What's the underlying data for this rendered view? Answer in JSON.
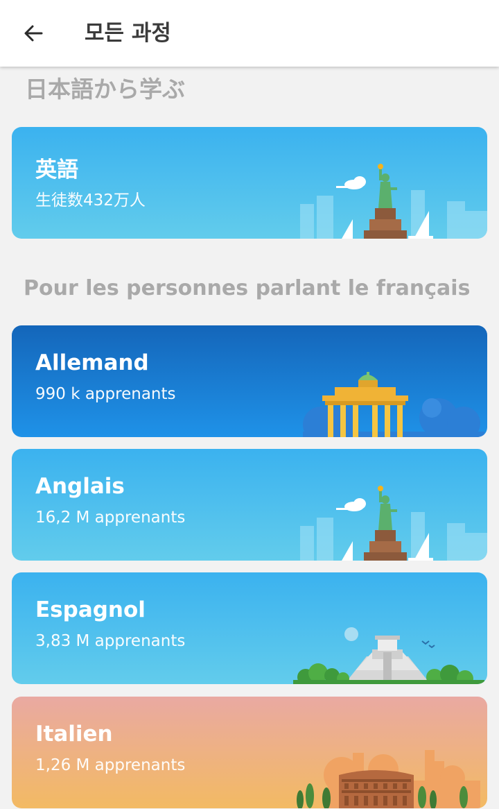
{
  "header": {
    "title": "모든 과정",
    "back_icon": "arrow-left-icon"
  },
  "sections": [
    {
      "title": "日本語から学ぶ",
      "courses": [
        {
          "name": "英語",
          "learners": "生徒数432万人",
          "theme": "sky",
          "scene": "statue-of-liberty"
        }
      ]
    },
    {
      "title": "Pour les personnes parlant le français",
      "courses": [
        {
          "name": "Allemand",
          "learners": "990 k apprenants",
          "theme": "deep",
          "scene": "brandenburg-gate"
        },
        {
          "name": "Anglais",
          "learners": "16,2 M apprenants",
          "theme": "sky",
          "scene": "statue-of-liberty"
        },
        {
          "name": "Espagnol",
          "learners": "3,83 M apprenants",
          "theme": "sky",
          "scene": "mayan-pyramid"
        },
        {
          "name": "Italien",
          "learners": "1,26 M apprenants",
          "theme": "warm",
          "scene": "colosseum"
        }
      ]
    }
  ],
  "colors": {
    "sky_top": "#3bb2ef",
    "sky_bottom": "#62ccec",
    "deep_top": "#1466ba",
    "deep_bottom": "#1f92e8",
    "warm_top": "#e9a9a2",
    "warm_bottom": "#f3ba63",
    "section_title": "#a9a9a9"
  }
}
